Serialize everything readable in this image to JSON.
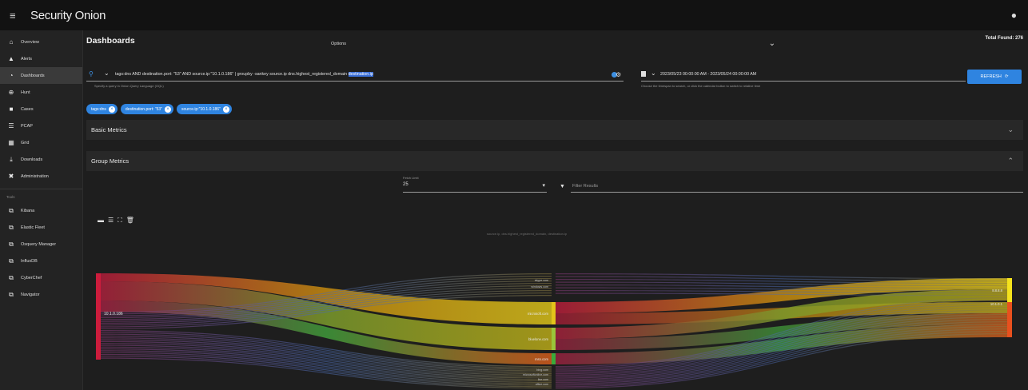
{
  "app": {
    "title": "Security Onion"
  },
  "sidebar": {
    "items": [
      {
        "label": "Overview",
        "icon": "home-icon"
      },
      {
        "label": "Alerts",
        "icon": "bell-icon"
      },
      {
        "label": "Dashboards",
        "icon": "dashboard-icon",
        "active": true
      },
      {
        "label": "Hunt",
        "icon": "crosshair-icon"
      },
      {
        "label": "Cases",
        "icon": "briefcase-icon"
      },
      {
        "label": "PCAP",
        "icon": "pcap-icon"
      },
      {
        "label": "Grid",
        "icon": "grid-icon"
      },
      {
        "label": "Downloads",
        "icon": "download-icon"
      },
      {
        "label": "Administration",
        "icon": "tools-icon"
      }
    ],
    "tools_heading": "Tools",
    "tools": [
      {
        "label": "Kibana"
      },
      {
        "label": "Elastic Fleet"
      },
      {
        "label": "Osquery Manager"
      },
      {
        "label": "InfluxDB"
      },
      {
        "label": "CyberChef"
      },
      {
        "label": "Navigator"
      }
    ]
  },
  "header": {
    "title": "Dashboards",
    "options_label": "Options",
    "total_found": "Total Found: 276"
  },
  "query": {
    "text": "tags:dns AND destination.port: \"53\" AND source.ip:\"10.1.0.186\" | groupby -sankey source.ip dns.highest_registered_domain ",
    "selected": "destination.ip",
    "hint": "Specify a query in Onion Query Language (OQL)"
  },
  "date_range": {
    "text": "2023/05/23 00:00:00 AM - 2023/05/24 00:00:00 AM",
    "hint": "Choose the timespan to search, or click the calendar button to switch to relative time"
  },
  "refresh": {
    "label": "REFRESH"
  },
  "filters": [
    {
      "label": "tags:dns"
    },
    {
      "label": "destination.port: \"53\""
    },
    {
      "label": "source.ip:\"10.1.0.186\""
    }
  ],
  "panels": {
    "basic": "Basic Metrics",
    "group": "Group Metrics"
  },
  "fetch": {
    "label": "Fetch Limit",
    "value": "25"
  },
  "filter_results": {
    "placeholder": "Filter Results"
  },
  "sankey": {
    "title": "source.ip, dns.highest_registered_domain, destination.ip",
    "source_label": "10.1.0.186",
    "middle_labels": [
      "microsoft.com",
      "bluelone.com",
      "msn.com",
      "bing.com",
      "microsoftonline.com",
      "live.com",
      "office.com",
      "skype.com",
      "windows.com"
    ],
    "right_labels": [
      "8.8.8.8",
      "10.1.0.1"
    ],
    "colors": {
      "source": "#cc1c3c",
      "top_band": "#e0b000",
      "mid_band": "#7fb23a",
      "right_top": "#f4e21c",
      "right_bottom": "#e8501e"
    }
  }
}
